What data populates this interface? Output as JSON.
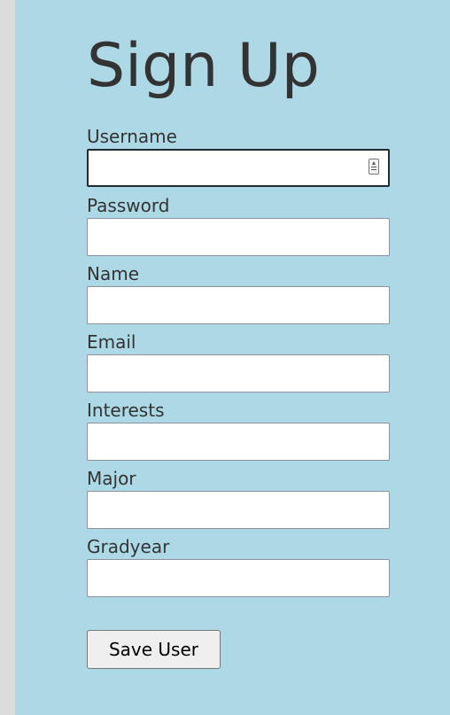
{
  "form": {
    "title": "Sign Up",
    "fields": [
      {
        "label": "Username",
        "value": ""
      },
      {
        "label": "Password",
        "value": ""
      },
      {
        "label": "Name",
        "value": ""
      },
      {
        "label": "Email",
        "value": ""
      },
      {
        "label": "Interests",
        "value": ""
      },
      {
        "label": "Major",
        "value": ""
      },
      {
        "label": "Gradyear",
        "value": ""
      }
    ],
    "submit_label": "Save User"
  },
  "colors": {
    "page_background": "#dcdcdc",
    "panel_background": "#add8e6",
    "text": "#333333"
  },
  "icons": {
    "username_field": "autofill-contact-icon"
  }
}
